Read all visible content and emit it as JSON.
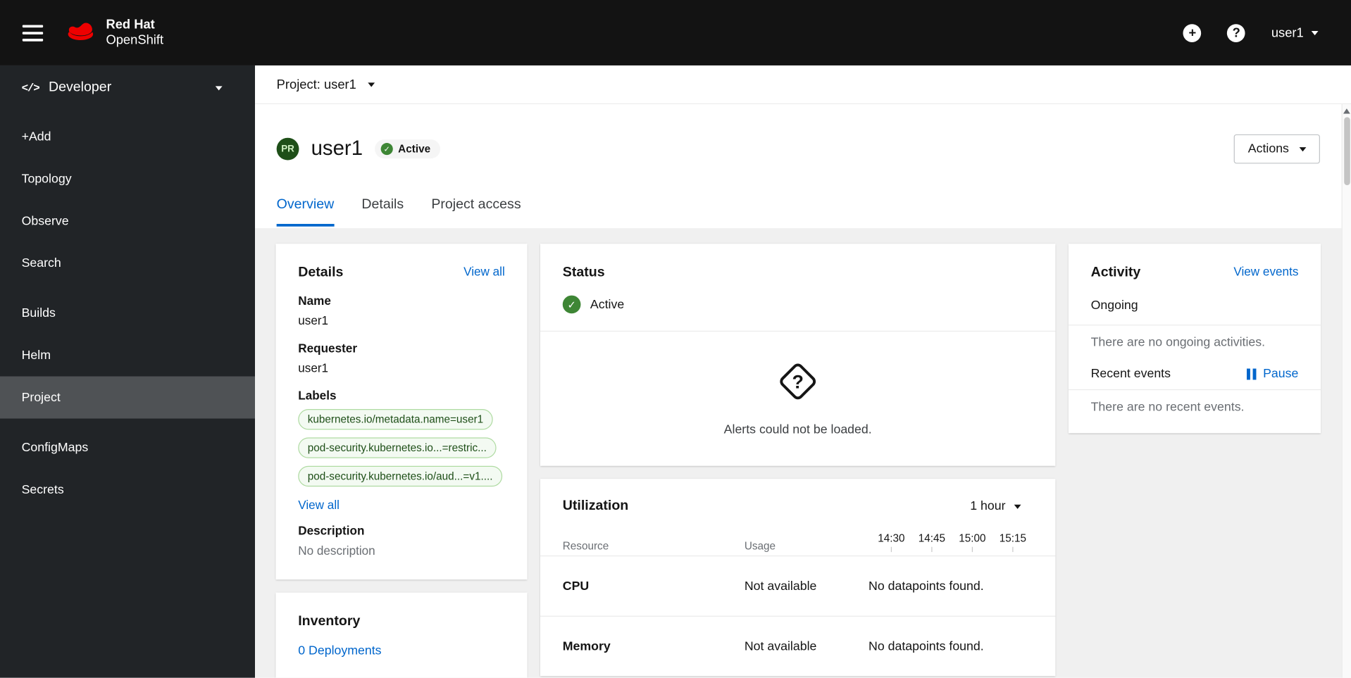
{
  "colors": {
    "accent": "#0066cc",
    "brand_red": "#ee0000",
    "status_green": "#3e8635",
    "label_bg": "#f3faf2",
    "label_border": "#afdba2",
    "label_text": "#1e4f18"
  },
  "masthead": {
    "brand_line1": "Red Hat",
    "brand_line2": "OpenShift",
    "plus_glyph": "+",
    "help_glyph": "?",
    "username": "user1"
  },
  "sidebar": {
    "perspective": {
      "icon_glyph": "</>",
      "label": "Developer"
    },
    "groups": [
      {
        "items": [
          {
            "label": "+Add"
          },
          {
            "label": "Topology"
          },
          {
            "label": "Observe"
          },
          {
            "label": "Search"
          }
        ]
      },
      {
        "items": [
          {
            "label": "Builds"
          },
          {
            "label": "Helm"
          },
          {
            "label": "Project"
          }
        ]
      },
      {
        "items": [
          {
            "label": "ConfigMaps"
          },
          {
            "label": "Secrets"
          }
        ]
      }
    ]
  },
  "breadcrumb": {
    "project_selector": "Project: user1"
  },
  "header": {
    "badge": "PR",
    "title": "user1",
    "status_label": "Active",
    "actions_label": "Actions"
  },
  "tabs": [
    {
      "label": "Overview"
    },
    {
      "label": "Details"
    },
    {
      "label": "Project access"
    }
  ],
  "details_card": {
    "title": "Details",
    "view_all": "View all",
    "name_label": "Name",
    "name_value": "user1",
    "requester_label": "Requester",
    "requester_value": "user1",
    "labels_label": "Labels",
    "labels": [
      "kubernetes.io/metadata.name=user1",
      "pod-security.kubernetes.io...=restric...",
      "pod-security.kubernetes.io/aud...=v1...."
    ],
    "labels_view_all": "View all",
    "description_label": "Description",
    "description_value": "No description"
  },
  "inventory_card": {
    "title": "Inventory",
    "deployments_link": "0 Deployments"
  },
  "status_card": {
    "title": "Status",
    "status_label": "Active",
    "alerts_empty": "Alerts could not be loaded."
  },
  "utilization_card": {
    "title": "Utilization",
    "duration": "1 hour",
    "resource_col": "Resource",
    "usage_col": "Usage",
    "times": [
      "14:30",
      "14:45",
      "15:00",
      "15:15"
    ],
    "rows": [
      {
        "resource": "CPU",
        "usage": "Not available",
        "datapoints": "No datapoints found."
      },
      {
        "resource": "Memory",
        "usage": "Not available",
        "datapoints": "No datapoints found."
      }
    ]
  },
  "activity_card": {
    "title": "Activity",
    "view_events": "View events",
    "ongoing_label": "Ongoing",
    "ongoing_empty": "There are no ongoing activities.",
    "recent_label": "Recent events",
    "pause_label": "Pause",
    "recent_empty": "There are no recent events."
  }
}
